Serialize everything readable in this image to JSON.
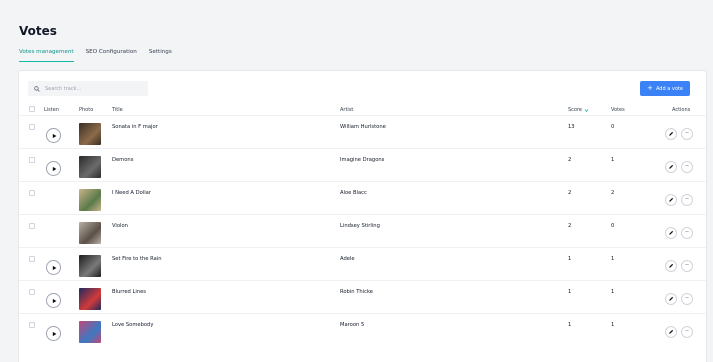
{
  "page": {
    "title": "Votes"
  },
  "tabs": [
    {
      "label": "Votes management",
      "active": true
    },
    {
      "label": "SEO Configuration",
      "active": false
    },
    {
      "label": "Settings",
      "active": false
    }
  ],
  "toolbar": {
    "search_placeholder": "Search track...",
    "search_icon": "search-icon",
    "add_label": "Add a vote",
    "add_icon": "plus-icon"
  },
  "table": {
    "headers": {
      "listen": "Listen",
      "photo": "Photo",
      "title": "Title",
      "artist": "Artist",
      "score": "Score",
      "score_sort_icon": "chevron-down-icon",
      "votes": "Votes",
      "actions": "Actions"
    },
    "rows": [
      {
        "title": "Sonata in F major",
        "artist": "William Hurlstone",
        "score": "13",
        "votes": "0",
        "has_play": true,
        "thumb_colors": [
          "#3a2e26",
          "#8c6b4a"
        ]
      },
      {
        "title": "Demons",
        "artist": "Imagine Dragons",
        "score": "2",
        "votes": "1",
        "has_play": true,
        "thumb_colors": [
          "#2a2a2a",
          "#6b6b6b"
        ]
      },
      {
        "title": "I Need A Dollar",
        "artist": "Aloe Blacc",
        "score": "2",
        "votes": "2",
        "has_play": false,
        "thumb_colors": [
          "#c9b48a",
          "#5a7a4a"
        ]
      },
      {
        "title": "Violon",
        "artist": "Lindsey Stirling",
        "score": "2",
        "votes": "0",
        "has_play": false,
        "thumb_colors": [
          "#b7b0a4",
          "#5b5048"
        ]
      },
      {
        "title": "Set Fire to the Rain",
        "artist": "Adele",
        "score": "1",
        "votes": "1",
        "has_play": true,
        "thumb_colors": [
          "#1d1d1d",
          "#7a7a7a"
        ]
      },
      {
        "title": "Blurred Lines",
        "artist": "Robin Thicke",
        "score": "1",
        "votes": "1",
        "has_play": true,
        "thumb_colors": [
          "#1e2a5e",
          "#d23a3a"
        ]
      },
      {
        "title": "Love Somebody",
        "artist": "Maroon 5",
        "score": "1",
        "votes": "1",
        "has_play": true,
        "thumb_colors": [
          "#c2467a",
          "#3a7ac2"
        ]
      }
    ],
    "action_icons": [
      "pencil-icon",
      "more-icon"
    ]
  },
  "colors": {
    "accent": "#14b8a6",
    "primary": "#3b82f6",
    "bg": "#f3f4f6"
  }
}
